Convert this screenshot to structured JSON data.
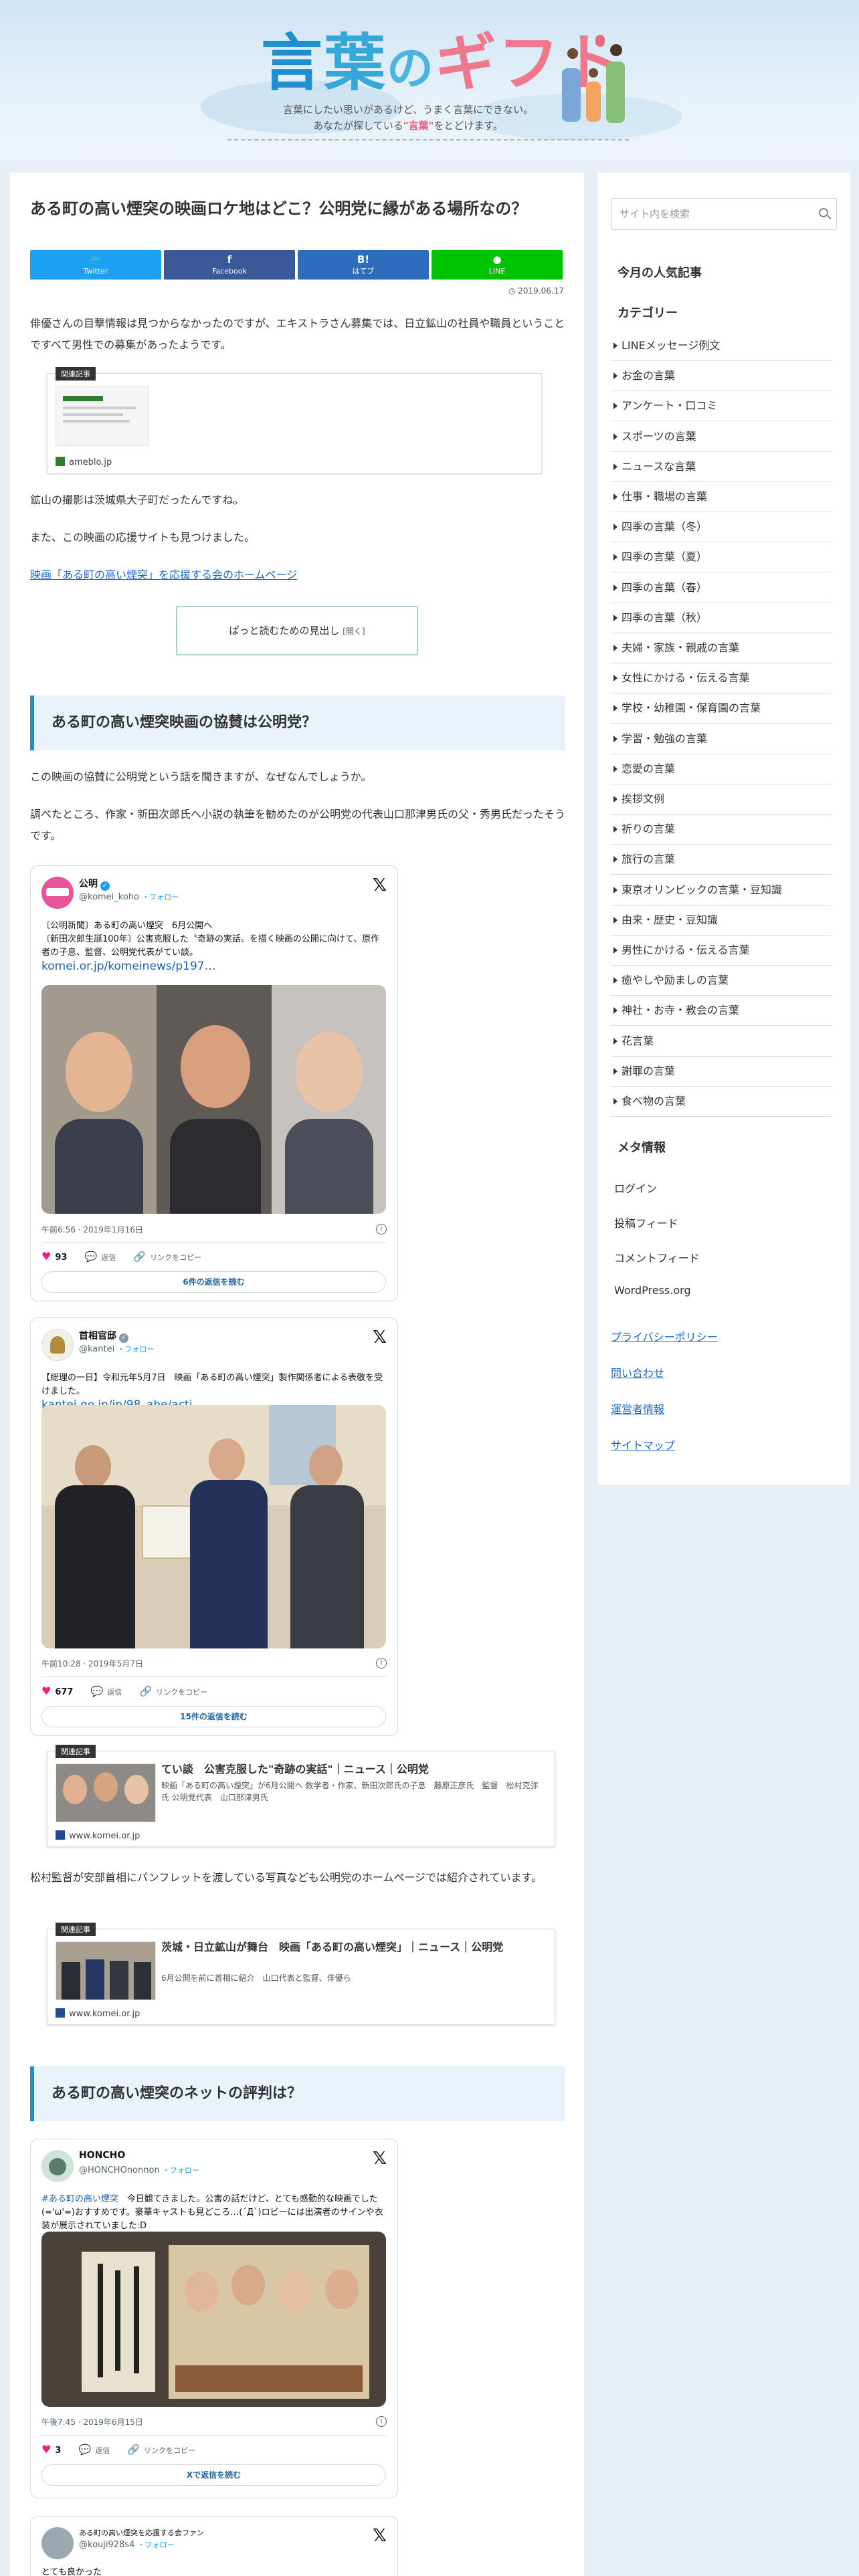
{
  "header": {
    "logo_chars": [
      "言",
      "葉",
      "の",
      "ギフト"
    ],
    "tagline_line1": "言葉にしたい思いがあるけど、うまく言葉にできない。",
    "tagline_pre": "あなたが探している",
    "tagline_highlight": "\"言葉\"",
    "tagline_post": "をとどけます。"
  },
  "post": {
    "title": "ある町の高い煙突の映画ロケ地はどこ？公明党に縁がある場所なの？",
    "date": "2019.06.17",
    "share": [
      {
        "icon": "twitter-icon",
        "symbol": "🐦",
        "label": "Twitter",
        "color": "#1da1f2"
      },
      {
        "icon": "facebook-icon",
        "symbol": "f",
        "label": "Facebook",
        "color": "#3b5998"
      },
      {
        "icon": "hatena-icon",
        "symbol": "B!",
        "label": "はてブ",
        "color": "#2c6ebd"
      },
      {
        "icon": "line-icon",
        "symbol": "●",
        "label": "LINE",
        "color": "#00c300"
      }
    ],
    "para1": "俳優さんの目撃情報は見つからなかったのですが、エキストラさん募集では、日立鉱山の社員や職員ということですべて男性での募集があったようです。",
    "card1": {
      "tag": "関連記事",
      "site": "ameblo.jp"
    },
    "para2": "鉱山の撮影は茨城県大子町だったんですね。",
    "para3": "また、この映画の応援サイトも見つけました。",
    "link1": "映画「ある町の高い煙突」を応援する会のホームページ",
    "toc_label": "ぱっと読むための見出し",
    "toc_open": "[開く]",
    "h2_1": "ある町の高い煙突映画の協賛は公明党？",
    "para4": "この映画の協賛に公明党という話を聞きますが、なぜなんでしょうか。",
    "para5": "調べたところ、作家・新田次郎氏へ小説の執筆を勧めたのが公明党の代表山口那津男氏の父・秀男氏だったそうです。",
    "card2": {
      "tag": "関連記事",
      "title": "てい談　公害克服した\"奇跡の実話\"｜ニュース｜公明党",
      "snippet": "映画「ある町の高い煙突」が6月公開へ 数学者・作家、新田次郎氏の子息　藤原正彦氏　監督　松村克弥氏 公明党代表　山口那津男氏",
      "site": "www.komei.or.jp"
    },
    "para6": "松村監督が安部首相にパンフレットを渡している写真なども公明党のホームページでは紹介されています。",
    "card3": {
      "tag": "関連記事",
      "title": "茨城・日立鉱山が舞台　映画「ある町の高い煙突」｜ニュース｜公明党",
      "snippet": "6月公開を前に首相に紹介　山口代表と監督、俳優ら",
      "site": "www.komei.or.jp"
    },
    "h2_2": "ある町の高い煙突のネットの評判は？"
  },
  "tweets": [
    {
      "name": "公明",
      "handle": "@komei_koho",
      "follow": "・フォロー",
      "text": "〔公明新聞〕ある町の高い煙突　6月公開へ\n〔新田次郎生誕100年〕公害克服した〝奇跡の実話〟を描く映画の公開に向けて、原作者の子息、監督、公明党代表がてい談。",
      "link": "komei.or.jp/komeinews/p197…",
      "time": "午前6:56 · 2019年1月16日",
      "likes": "93",
      "reply": "返信",
      "copy": "リンクをコピー",
      "more": "6件の返信を読む"
    },
    {
      "name": "首相官邸",
      "handle": "@kantei",
      "follow": "・フォロー",
      "text": "【総理の一日】令和元年5月7日　映画「ある町の高い煙突」製作関係者による表敬を受けました。",
      "link": "kantei.go.jp/jp/98_abe/acti…",
      "time": "午前10:28 · 2019年5月7日",
      "likes": "677",
      "reply": "返信",
      "copy": "リンクをコピー",
      "more": "15件の返信を読む"
    },
    {
      "name": "HONCHO",
      "handle": "@HONCHOnonnon",
      "follow": "・フォロー",
      "hashtag": "#ある町の高い煙突",
      "text": "　今日観てきました。公害の話だけど、とても感動的な映画でした(='ω'=)おすすめです。豪華キャストも見どころ…(´Д`)ロビーには出演者のサインや衣装が展示されていました:D",
      "time": "午後7:45 · 2019年6月15日",
      "likes": "3",
      "reply": "返信",
      "copy": "リンクをコピー",
      "more": "Xで返信を読む"
    },
    {
      "name": "ある町の高い煙突を応援する会ファン",
      "handle": "@kouji928s4",
      "follow": "・フォロー",
      "text": "とても良かった"
    }
  ],
  "sidebar": {
    "search_placeholder": "サイト内を検索",
    "popular_heading": "今月の人気記事",
    "category_heading": "カテゴリー",
    "categories": [
      "LINEメッセージ例文",
      "お金の言葉",
      "アンケート・口コミ",
      "スポーツの言葉",
      "ニュースな言葉",
      "仕事・職場の言葉",
      "四季の言葉（冬）",
      "四季の言葉（夏）",
      "四季の言葉（春）",
      "四季の言葉（秋）",
      "夫婦・家族・親戚の言葉",
      "女性にかける・伝える言葉",
      "学校・幼稚園・保育園の言葉",
      "学習・勉強の言葉",
      "恋愛の言葉",
      "挨拶文例",
      "祈りの言葉",
      "旅行の言葉",
      "東京オリンピックの言葉・豆知識",
      "由来・歴史・豆知識",
      "男性にかける・伝える言葉",
      "癒やしや励ましの言葉",
      "神社・お寺・教会の言葉",
      "花言葉",
      "謝罪の言葉",
      "食べ物の言葉"
    ],
    "meta_heading": "メタ情報",
    "meta_items": [
      "ログイン",
      "投稿フィード",
      "コメントフィード",
      "WordPress.org"
    ],
    "links": [
      "プライバシーポリシー",
      "問い合わせ",
      "運営者情報",
      "サイトマップ"
    ]
  }
}
